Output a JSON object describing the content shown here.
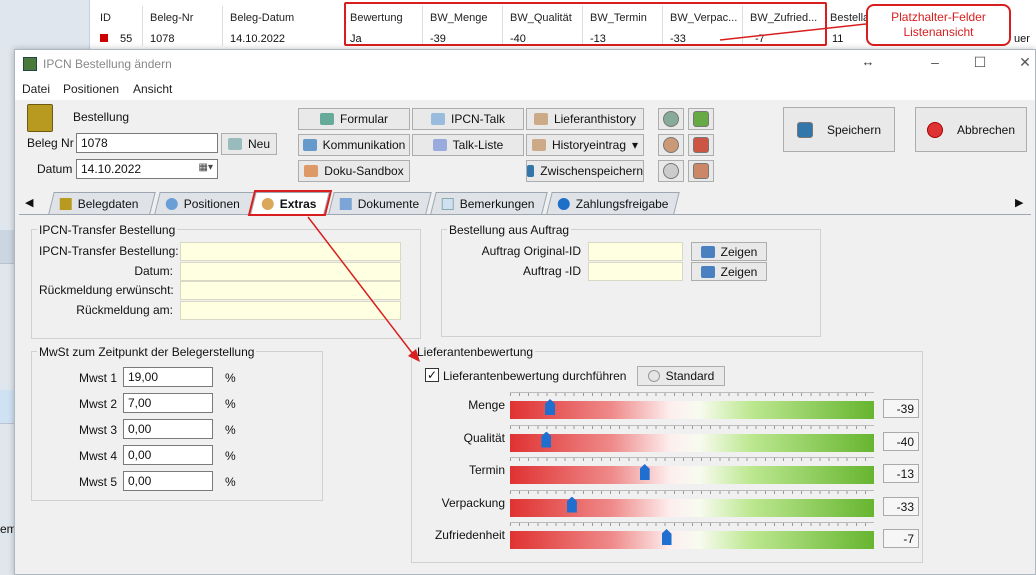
{
  "list": {
    "headers": [
      "ID",
      "Beleg-Nr",
      "Beleg-Datum",
      "Bewertung",
      "BW_Menge",
      "BW_Qualität",
      "BW_Termin",
      "BW_Verpac...",
      "BW_Zufried...",
      "Bestella"
    ],
    "row": [
      "55",
      "1078",
      "14.10.2022",
      "Ja",
      "-39",
      "-40",
      "-13",
      "-33",
      "-7",
      "11"
    ],
    "trailing_text": "uer",
    "left_text": "em"
  },
  "callout": {
    "line1": "Platzhalter-Felder",
    "line2": "Listenansicht"
  },
  "window": {
    "title": "IPCN Bestellung ändern",
    "menu": [
      "Datei",
      "Positionen",
      "Ansicht"
    ],
    "header": {
      "title": "Bestellung",
      "beleg_label": "Beleg Nr",
      "beleg_value": "1078",
      "neu_label": "Neu",
      "datum_label": "Datum",
      "datum_value": "14.10.2022"
    },
    "buttons": {
      "formular": "Formular",
      "kommunikation": "Kommunikation",
      "doku": "Doku-Sandbox",
      "ipcn_talk": "IPCN-Talk",
      "talk_liste": "Talk-Liste",
      "lieferant": "Lieferanthistory",
      "history": "Historyeintrag",
      "zwischen": "Zwischenspeichern",
      "speichern": "Speichern",
      "abbrechen": "Abbrechen"
    },
    "tabs": [
      "Belegdaten",
      "Positionen",
      "Extras",
      "Dokumente",
      "Bemerkungen",
      "Zahlungsfreigabe"
    ],
    "ipcn_group": {
      "title": "IPCN-Transfer Bestellung",
      "fields": [
        "IPCN-Transfer Bestellung:",
        "Datum:",
        "Rückmeldung erwünscht:",
        "Rückmeldung am:"
      ]
    },
    "auftrag_group": {
      "title": "Bestellung aus Auftrag",
      "fields": [
        "Auftrag Original-ID",
        "Auftrag -ID"
      ],
      "zeigen": "Zeigen"
    },
    "mwst_group": {
      "title": "MwSt zum Zeitpunkt der Belegerstellung",
      "rows": [
        {
          "label": "Mwst 1",
          "value": "19,00",
          "unit": "%"
        },
        {
          "label": "Mwst 2",
          "value": "7,00",
          "unit": "%"
        },
        {
          "label": "Mwst 3",
          "value": "0,00",
          "unit": "%"
        },
        {
          "label": "Mwst 4",
          "value": "0,00",
          "unit": "%"
        },
        {
          "label": "Mwst 5",
          "value": "0,00",
          "unit": "%"
        }
      ]
    },
    "lieferanten": {
      "title": "Lieferantenbewertung",
      "checkbox_label": "Lieferantenbewertung durchführen",
      "checked": true,
      "standard_label": "Standard",
      "scale_min": -50,
      "scale_max": 50,
      "ratings": [
        {
          "label": "Menge",
          "value": "-39",
          "level": -39
        },
        {
          "label": "Qualität",
          "value": "-40",
          "level": -40
        },
        {
          "label": "Termin",
          "value": "-13",
          "level": -13
        },
        {
          "label": "Verpackung",
          "value": "-33",
          "level": -33
        },
        {
          "label": "Zufriedenheit",
          "value": "-7",
          "level": -7
        }
      ]
    }
  },
  "colors": {
    "highlight_red": "#d81e1e",
    "thumb_blue": "#1e6fd0",
    "field_yellow": "#ffffe1"
  }
}
